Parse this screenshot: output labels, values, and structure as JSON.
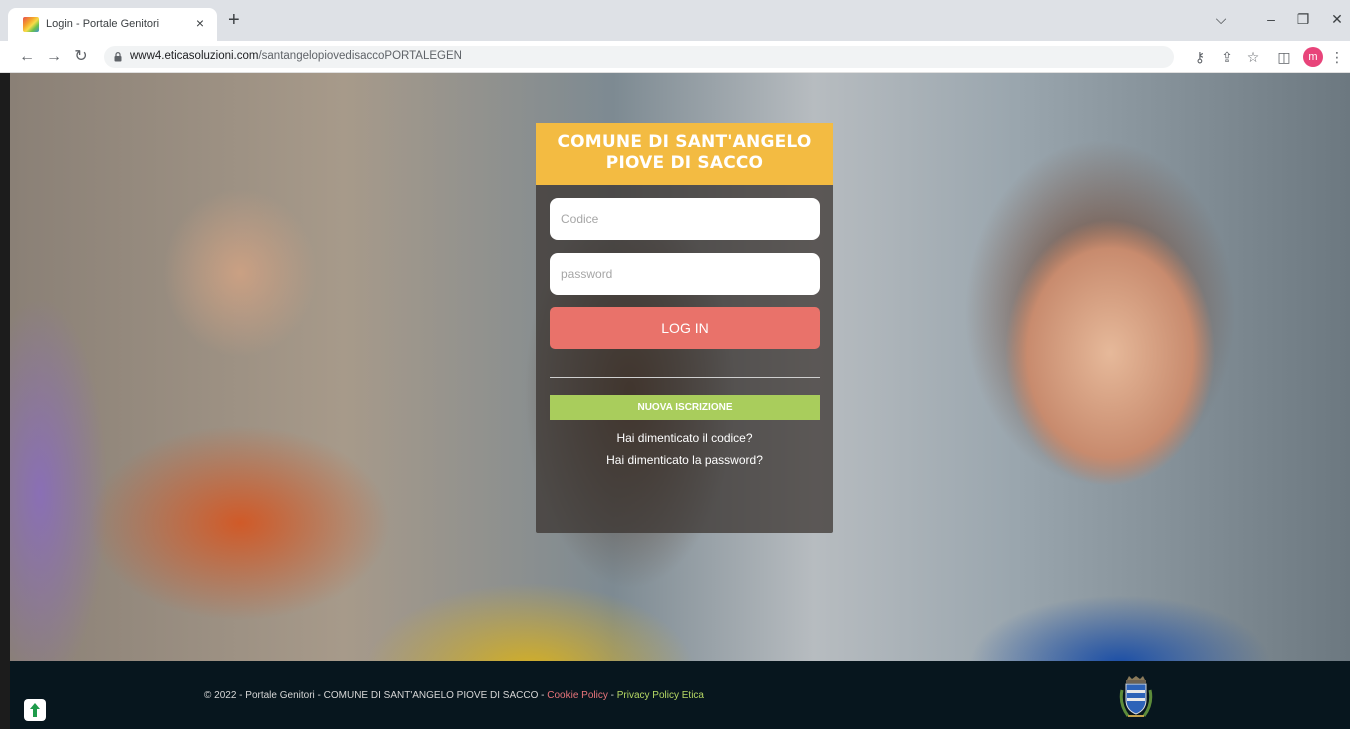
{
  "browser": {
    "tab_title": "Login - Portale Genitori",
    "tab_close": "×",
    "new_tab": "+",
    "url_domain": "www4.eticasoluzioni.com",
    "url_path": "/santangelopiovedisaccoPORTALEGEN",
    "profile_initial": "m",
    "icons": [
      "back-icon",
      "forward-icon",
      "reload-icon",
      "lock-icon",
      "key-icon",
      "share-icon",
      "star-icon",
      "sidepanel-icon",
      "menu-icon"
    ]
  },
  "login": {
    "header": "COMUNE DI SANT'ANGELO PIOVE DI SACCO",
    "code_placeholder": "Codice",
    "password_placeholder": "password",
    "login_button": "LOG IN",
    "signup_button": "NUOVA ISCRIZIONE",
    "forgot_code": "Hai dimenticato il codice?",
    "forgot_password": "Hai dimenticato la password?"
  },
  "footer": {
    "copyright": "© 2022 - Portale Genitori - COMUNE DI SANT'ANGELO PIOVE DI SACCO - ",
    "cookie_policy": "Cookie Policy",
    "separator": " - ",
    "privacy_policy": "Privacy Policy Etica"
  },
  "colors": {
    "header_yellow": "#f3bb42",
    "login_red": "#e9726a",
    "signup_green": "#a9cd5c",
    "footer_bg": "#07161e"
  }
}
